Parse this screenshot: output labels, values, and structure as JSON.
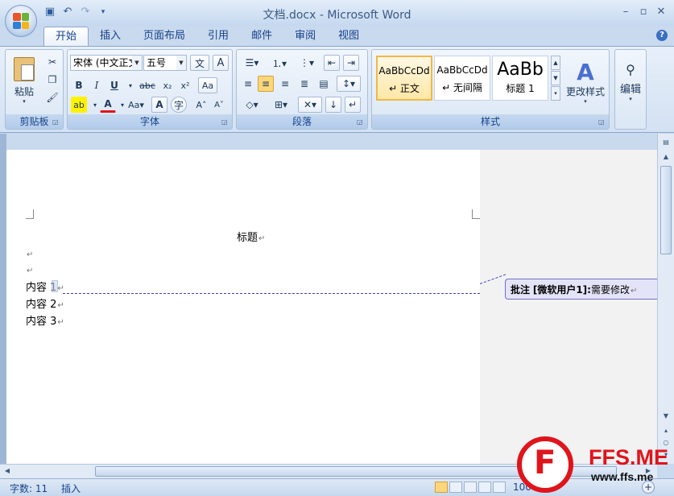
{
  "window": {
    "title": "文档.docx - Microsoft Word"
  },
  "qat": {
    "save_icon": "save-icon",
    "undo_icon": "undo-icon",
    "redo_icon": "redo-icon"
  },
  "tabs": [
    {
      "label": "开始",
      "active": true
    },
    {
      "label": "插入"
    },
    {
      "label": "页面布局"
    },
    {
      "label": "引用"
    },
    {
      "label": "邮件"
    },
    {
      "label": "审阅"
    },
    {
      "label": "视图"
    }
  ],
  "ribbon": {
    "clipboard": {
      "label": "剪贴板",
      "paste": "粘贴"
    },
    "font": {
      "label": "字体",
      "font_name": "宋体 (中文正文)",
      "font_size": "五号"
    },
    "paragraph": {
      "label": "段落"
    },
    "styles": {
      "label": "样式",
      "items": [
        {
          "sample": "AaBbCcDd",
          "name": "↵ 正文"
        },
        {
          "sample": "AaBbCcDd",
          "name": "↵ 无间隔"
        },
        {
          "sample": "AaBb",
          "name": "标题 1"
        }
      ],
      "change_styles": "更改样式"
    },
    "editing": {
      "label": "编辑"
    }
  },
  "document": {
    "title": "标题",
    "para_mark": "↵",
    "lines": [
      "内容 1",
      "内容 2",
      "内容 3"
    ]
  },
  "comment": {
    "label": "批注",
    "author": "[微软用户1]:",
    "text": "需要修改"
  },
  "status": {
    "word_count": "字数: 11",
    "mode": "插入",
    "zoom": "100%"
  },
  "watermark": {
    "brand": "FFS.ME",
    "url": "www.ffs.me"
  },
  "colors": {
    "accent": "#15428b",
    "highlight": "#ffd67a",
    "comment_border": "#6f6fc8"
  }
}
